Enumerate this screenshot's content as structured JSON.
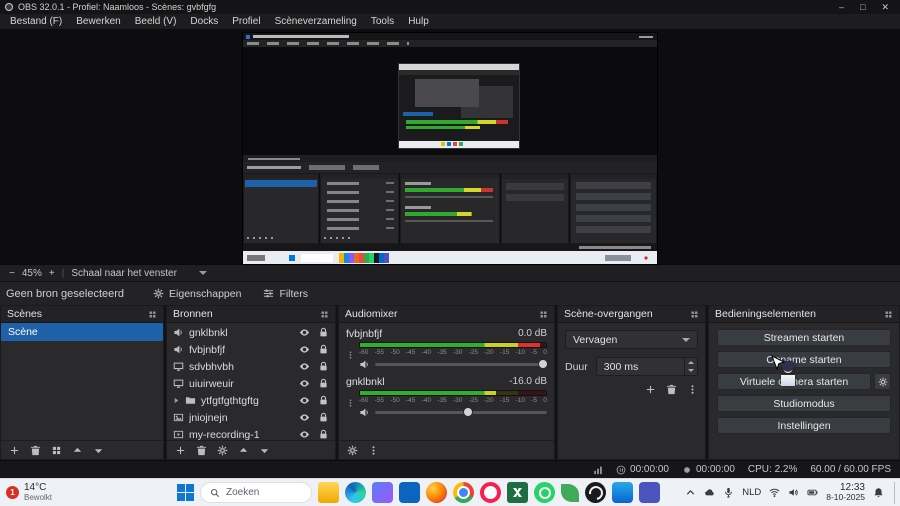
{
  "colors": {
    "accent_blue": "#1f61a8",
    "panel_bg": "#2a2a2d",
    "meter_green": "#2bb12b",
    "meter_yellow": "#cfcf1f",
    "meter_red": "#e03131",
    "taskbar_bg": "#eef1f5",
    "badge_red": "#d93025"
  },
  "titlebar": {
    "title": "OBS 32.0.1 - Profiel: Naamloos - Scènes: gvbfgfg",
    "minimize": "–",
    "maximize": "□",
    "close": "✕"
  },
  "menu": {
    "items": [
      "Bestand (F)",
      "Bewerken",
      "Beeld (V)",
      "Docks",
      "Profiel",
      "Scèneverzameling",
      "Tools",
      "Hulp"
    ]
  },
  "zoom": {
    "minus": "−",
    "level": "45%",
    "plus": "+",
    "separator": "|",
    "scale_label": "Schaal naar het venster"
  },
  "selection": {
    "status": "Geen bron geselecteerd",
    "properties": "Eigenschappen",
    "filters": "Filters"
  },
  "scenes": {
    "title": "Scènes",
    "rows": [
      {
        "label": "Scène",
        "selected": true
      }
    ]
  },
  "sources": {
    "title": "Bronnen",
    "rows": [
      {
        "label": "gnklbnkl",
        "type": "audio"
      },
      {
        "label": "fvbjnbfjf",
        "type": "audio"
      },
      {
        "label": "sdvbhvbh",
        "type": "display"
      },
      {
        "label": "uiuirweuir",
        "type": "display"
      },
      {
        "label": "ytfgtfgthtgftg",
        "type": "group"
      },
      {
        "label": "jniojnejn",
        "type": "image"
      },
      {
        "label": "my-recording-1",
        "type": "media"
      }
    ]
  },
  "mixer": {
    "title": "Audiomixer",
    "ticks": [
      "-60",
      "-55",
      "-50",
      "-45",
      "-40",
      "-35",
      "-30",
      "-25",
      "-20",
      "-15",
      "-10",
      "-5",
      "0"
    ],
    "channels": [
      {
        "name": "fvbjnbfjf",
        "db": "0.0 dB"
      },
      {
        "name": "gnklbnkl",
        "db": "-16.0 dB"
      }
    ]
  },
  "transitions": {
    "title": "Scène-overgangen",
    "selected": "Vervagen",
    "duration_label": "Duur",
    "duration_value": "300 ms"
  },
  "controls": {
    "title": "Bedieningselementen",
    "stream": "Streamen starten",
    "record": "Opname starten",
    "vcam": "Virtuele camera starten",
    "studio": "Studiomodus",
    "settings": "Instellingen"
  },
  "statusbar": {
    "stream_time": "00:00:00",
    "rec_time": "00:00:00",
    "cpu": "CPU: 2.2%",
    "fps": "60.00 / 60.00 FPS"
  },
  "taskbar": {
    "weather_badge": "1",
    "temp": "14°C",
    "condition": "Bewolkt",
    "search": "Zoeken",
    "lang": "NLD",
    "time": "12:33",
    "date": "8-10-2025",
    "app_icons": [
      "file-explorer",
      "edge",
      "photos",
      "mail",
      "firefox",
      "chrome",
      "opera",
      "excel",
      "whatsapp",
      "leaf",
      "obs",
      "onedrive",
      "teams"
    ],
    "tray_icons": [
      "chevron-up",
      "onedrive-cloud",
      "microphone",
      "language",
      "wifi",
      "volume",
      "battery",
      "clock",
      "bell",
      "show-desktop"
    ]
  }
}
